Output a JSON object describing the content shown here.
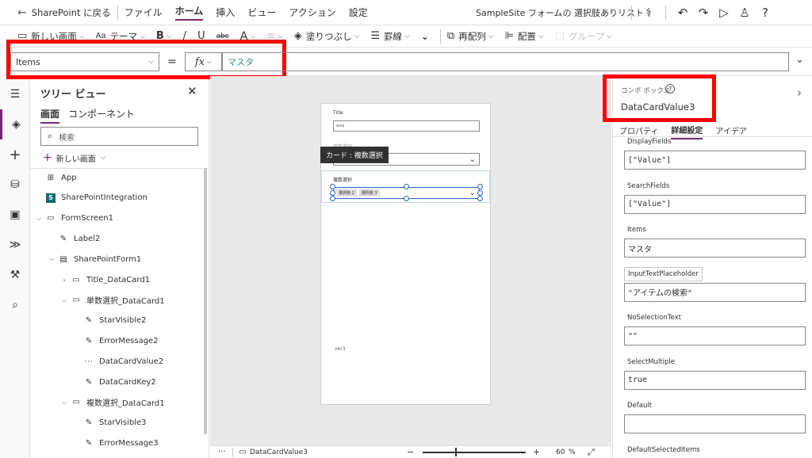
{
  "topbar": {
    "back_label": "SharePoint に戻る",
    "menus": [
      "ファイル",
      "ホーム",
      "挿入",
      "ビュー",
      "アクション",
      "設定"
    ],
    "active_menu": "ホーム",
    "app_title": "SampleSite フォームの 選択肢ありリスト"
  },
  "ribbon": {
    "new_screen": "新しい画面",
    "theme": "テーマ",
    "bold": "B",
    "italic": "/",
    "underline": "U",
    "strike": "abc",
    "font_color": "A",
    "fill": "塗りつぶし",
    "border": "罫線",
    "reorder": "再配列",
    "align": "配置",
    "group": "グループ"
  },
  "formula": {
    "property": "Items",
    "equals": "=",
    "fx": "fx",
    "value": "マスタ"
  },
  "tree": {
    "title": "ツリー ビュー",
    "tabs": [
      "画面",
      "コンポーネント"
    ],
    "search_placeholder": "検索",
    "new_screen": "新しい画面",
    "items": [
      {
        "label": "App",
        "level": 0,
        "icon": "app-icon",
        "chev": ""
      },
      {
        "label": "SharePointIntegration",
        "level": 0,
        "icon": "sharepoint-icon",
        "chev": ""
      },
      {
        "label": "FormScreen1",
        "level": 0,
        "icon": "screen-icon",
        "chev": "v"
      },
      {
        "label": "Label2",
        "level": 1,
        "icon": "label-icon",
        "chev": ""
      },
      {
        "label": "SharePointForm1",
        "level": 1,
        "icon": "form-icon",
        "chev": "v"
      },
      {
        "label": "Title_DataCard1",
        "level": 2,
        "icon": "card-icon",
        "chev": ">"
      },
      {
        "label": "単数選択_DataCard1",
        "level": 2,
        "icon": "card-icon",
        "chev": "v"
      },
      {
        "label": "StarVisible2",
        "level": 3,
        "icon": "label-icon",
        "chev": ""
      },
      {
        "label": "ErrorMessage2",
        "level": 3,
        "icon": "label-icon",
        "chev": ""
      },
      {
        "label": "DataCardValue2",
        "level": 3,
        "icon": "dropdown-icon",
        "chev": ""
      },
      {
        "label": "DataCardKey2",
        "level": 3,
        "icon": "label-icon",
        "chev": ""
      },
      {
        "label": "複数選択_DataCard1",
        "level": 2,
        "icon": "card-icon",
        "chev": "v"
      },
      {
        "label": "StarVisible3",
        "level": 3,
        "icon": "label-icon",
        "chev": ""
      },
      {
        "label": "ErrorMessage3",
        "level": 3,
        "icon": "label-icon",
        "chev": ""
      }
    ]
  },
  "canvas": {
    "title_label": "Title",
    "title_value": "aaa",
    "single_label": "単数選択",
    "tooltip": "カード : 複数選択",
    "multi_label": "複数選択",
    "chips": [
      "選択肢 2",
      "選択肢 3"
    ],
    "footer": "ver3"
  },
  "status": {
    "dots": "···",
    "control": "DataCardValue3",
    "minus": "−",
    "plus": "+",
    "zoom": "60",
    "zoom_unit": "%"
  },
  "props": {
    "type": "コンボ ボックス",
    "name": "DataCardValue3",
    "tabs": [
      "プロパティ",
      "詳細設定",
      "アイデア"
    ],
    "active_tab": "詳細設定",
    "fields": [
      {
        "label": "DisplayFields",
        "value": "[\"Value\"]"
      },
      {
        "label": "SearchFields",
        "value": "[\"Value\"]"
      },
      {
        "label": "Items",
        "value": "マスタ"
      },
      {
        "label": "InputTextPlaceholder",
        "value": "\"アイテムの検索\""
      },
      {
        "label": "NoSelectionText",
        "value": "\"\""
      },
      {
        "label": "SelectMultiple",
        "value": "true"
      },
      {
        "label": "Default",
        "value": ""
      },
      {
        "label": "DefaultSelectedItems",
        "value": ""
      }
    ]
  },
  "colors": {
    "accent": "#742774",
    "highlight": "#ff0000",
    "selection": "#2564cf"
  }
}
